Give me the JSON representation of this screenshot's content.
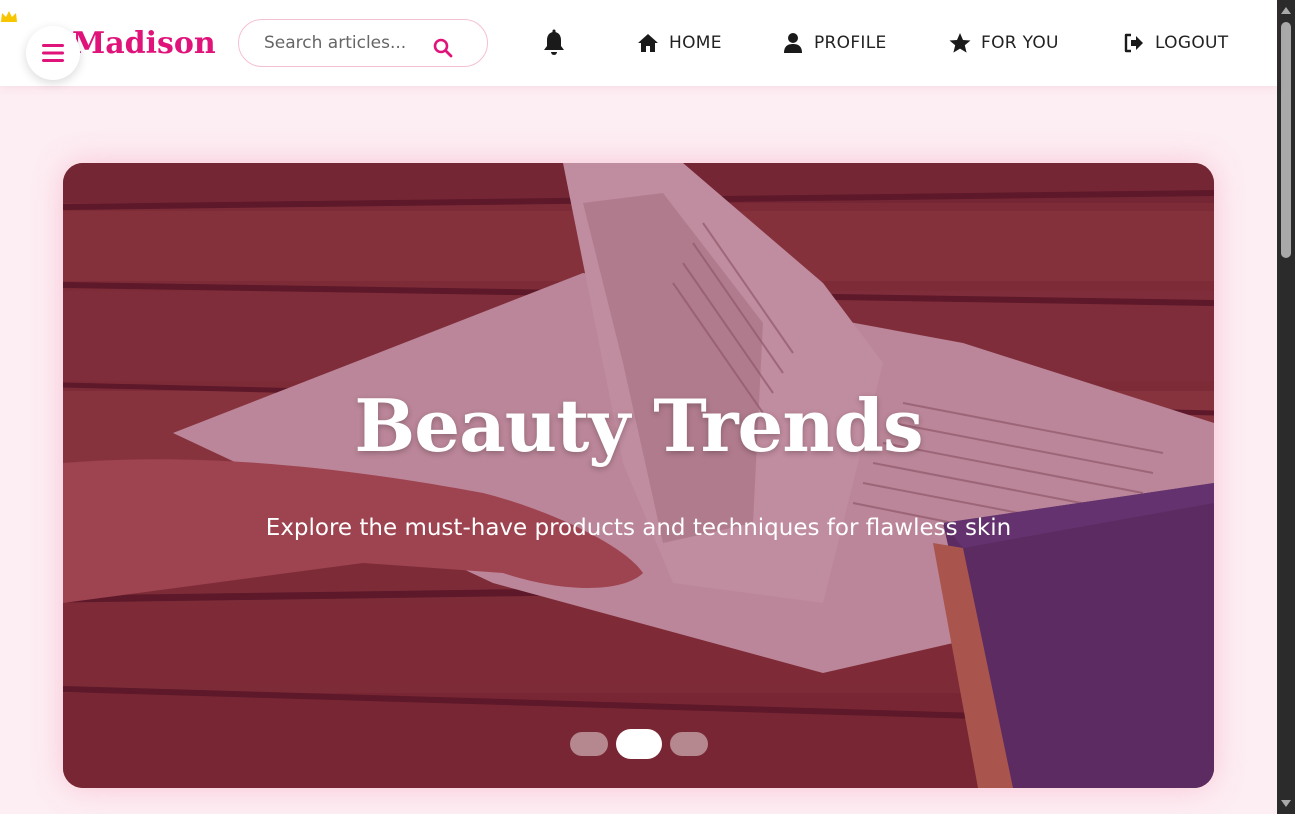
{
  "brand": {
    "name": "Madison"
  },
  "search": {
    "placeholder": "Search articles..."
  },
  "nav": [
    {
      "label": "HOME",
      "icon": "home-icon"
    },
    {
      "label": "PROFILE",
      "icon": "user-icon"
    },
    {
      "label": "FOR YOU",
      "icon": "star-icon"
    },
    {
      "label": "LOGOUT",
      "icon": "logout-icon"
    }
  ],
  "hero": {
    "title": "Beauty Trends",
    "subtitle": "Explore the must-have products and techniques for flawless skin",
    "slides": 3,
    "active_slide": 2
  },
  "colors": {
    "brand": "#e0137a",
    "page_background": "#fdeef3",
    "hero_overlay": "#82144680"
  }
}
